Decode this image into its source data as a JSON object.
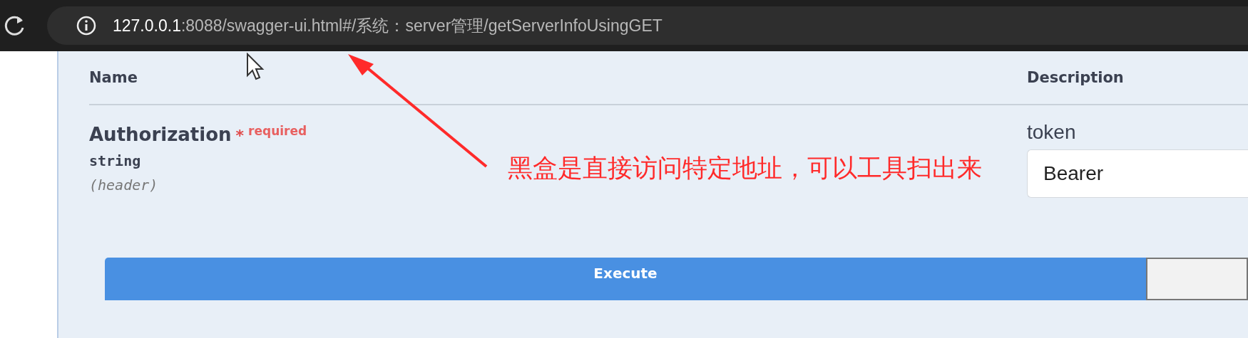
{
  "browser": {
    "url_host": "127.0.0.1",
    "url_rest": ":8088/swagger-ui.html#/系统：server管理/getServerInfoUsingGET"
  },
  "parameters": {
    "columns": [
      "Name",
      "Description"
    ],
    "rows": [
      {
        "name": "Authorization",
        "required_mark": "*",
        "required_label": "required",
        "type": "string",
        "location": "(header)",
        "description": "token",
        "value": "Bearer"
      }
    ]
  },
  "annotation": {
    "text": "黑盒是直接访问特定地址，可以工具扫出来"
  },
  "buttons": [
    {
      "kind": "primary",
      "label": "Execute"
    },
    {
      "kind": "secondary"
    }
  ]
}
